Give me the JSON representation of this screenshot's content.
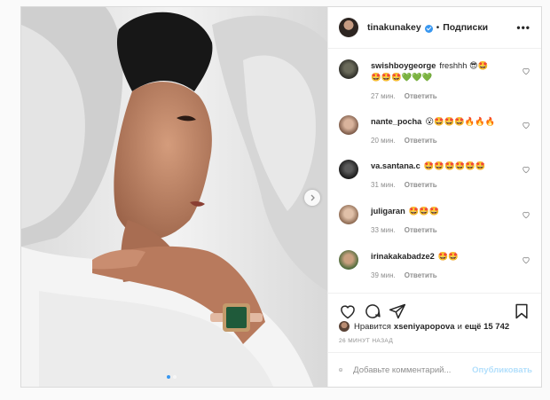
{
  "post": {
    "photo": {
      "alt": "",
      "slide_count": 2,
      "active_slide": 1
    }
  },
  "header": {
    "username": "tinakunakey",
    "separator": "•",
    "follow_label": "Подписки",
    "more_icon": "more-icon"
  },
  "comments": [
    {
      "username": "swishboygeorge",
      "text": "freshhh 😎🤩",
      "text_line2": "🤩🤩🤩💚💚💚",
      "time": "27 мин.",
      "reply": "Ответить"
    },
    {
      "username": "nante_pocha",
      "text": "😮🤩🤩🤩🔥🔥🔥",
      "time": "20 мин.",
      "reply": "Ответить"
    },
    {
      "username": "va.santana.c",
      "text": "🤩🤩🤩🤩🤩🤩",
      "time": "31 мин.",
      "reply": "Ответить"
    },
    {
      "username": "juligaran",
      "text": "🤩🤩🤩",
      "time": "33 мин.",
      "reply": "Ответить"
    },
    {
      "username": "irinakakabadze2",
      "text": "🤩🤩",
      "time": "39 мин.",
      "reply": "Ответить"
    }
  ],
  "likes": {
    "prefix": "Нравится",
    "user": "xseniyapopova",
    "middle": "и",
    "count": "ещё 15 742"
  },
  "timestamp": "26 МИНУТ НАЗАД",
  "add_comment": {
    "placeholder": "Добавьте комментарий...",
    "publish_label": "Опубликовать"
  },
  "colors": {
    "accent": "#3897f0",
    "publish_disabled": "#b2dffc",
    "muted": "#8e8e8e",
    "watch_dial": "#1f5a3a"
  }
}
